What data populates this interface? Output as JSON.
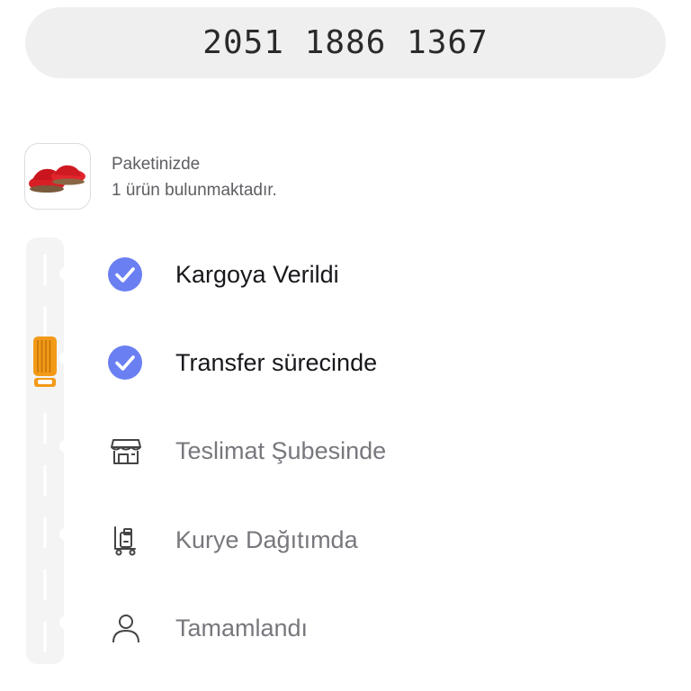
{
  "tracking": {
    "number": "2051 1886 1367"
  },
  "package": {
    "title": "Paketinizde",
    "subtitle": "1 ürün bulunmaktadır.",
    "thumbnail_icon": "red-slipper-product-image"
  },
  "colors": {
    "check": "#6a7ff1",
    "truck": "#f29a17",
    "road": "#f4f4f4"
  },
  "steps": [
    {
      "label": "Kargoya Verildi",
      "status": "done",
      "icon": "check-circle-icon"
    },
    {
      "label": "Transfer sürecinde",
      "status": "done",
      "icon": "check-circle-icon"
    },
    {
      "label": "Teslimat Şubesinde",
      "status": "pending",
      "icon": "store-icon"
    },
    {
      "label": "Kurye Dağıtımda",
      "status": "pending",
      "icon": "courier-cart-icon"
    },
    {
      "label": "Tamamlandı",
      "status": "pending",
      "icon": "person-icon"
    }
  ]
}
